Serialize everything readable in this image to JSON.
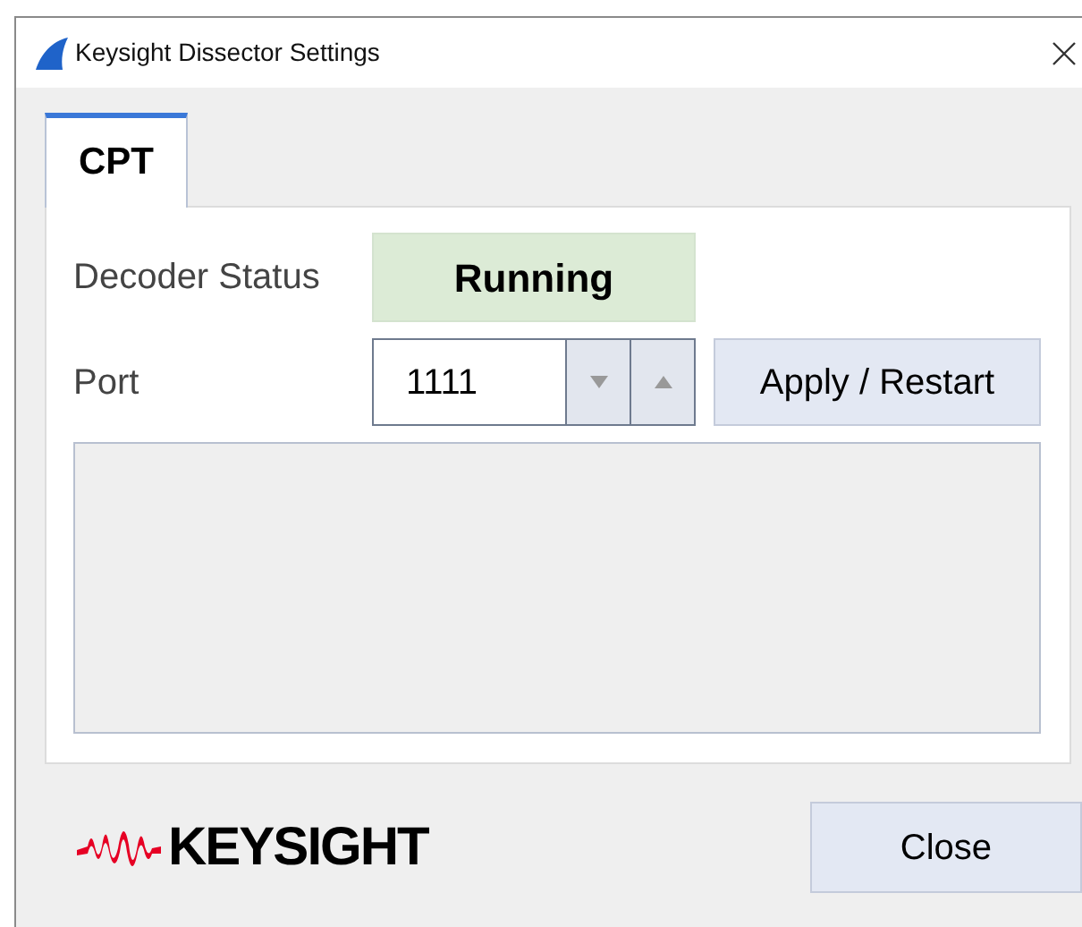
{
  "window": {
    "title": "Keysight Dissector Settings"
  },
  "tabs": [
    {
      "label": "CPT",
      "selected": true
    }
  ],
  "decoder_status": {
    "label": "Decoder Status",
    "value": "Running"
  },
  "port": {
    "label": "Port",
    "value": "1111"
  },
  "apply_button": "Apply / Restart",
  "logo": {
    "text": "KEYSIGHT"
  },
  "close_button": "Close"
}
